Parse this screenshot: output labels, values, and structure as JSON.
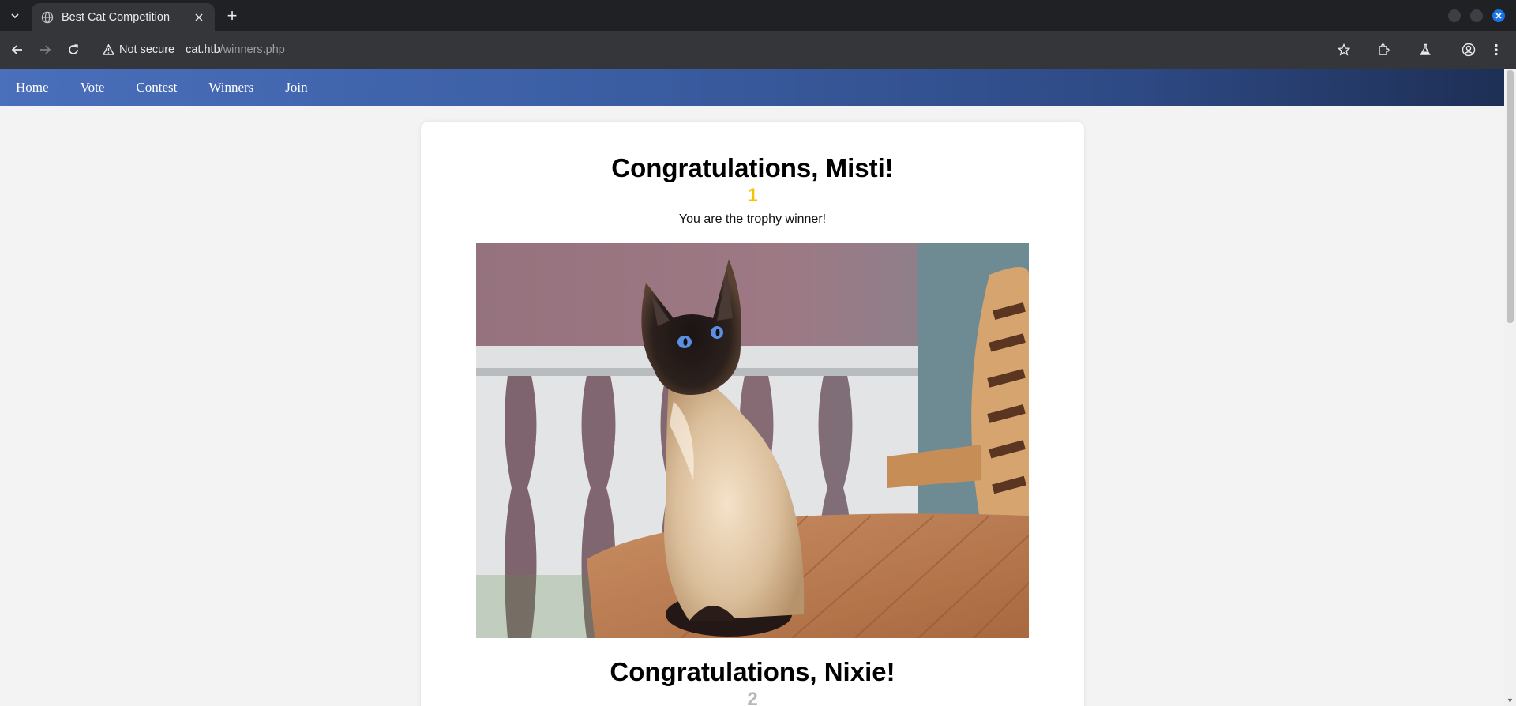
{
  "browser": {
    "tab_title": "Best Cat Competition",
    "new_tab_label": "+",
    "security_label": "Not secure",
    "url_host": "cat.htb",
    "url_path": "/winners.php"
  },
  "nav": {
    "items": [
      "Home",
      "Vote",
      "Contest",
      "Winners",
      "Join"
    ]
  },
  "winners": [
    {
      "heading": "Congratulations, Misti!",
      "rank": "1",
      "message": "You are the trophy winner!"
    },
    {
      "heading": "Congratulations, Nixie!",
      "rank": "2"
    }
  ],
  "colors": {
    "gold_rank": "#f2c400",
    "silver_rank": "#b8b8b8",
    "navbar_start": "#4a6fbb",
    "navbar_end": "#1e2f55"
  }
}
